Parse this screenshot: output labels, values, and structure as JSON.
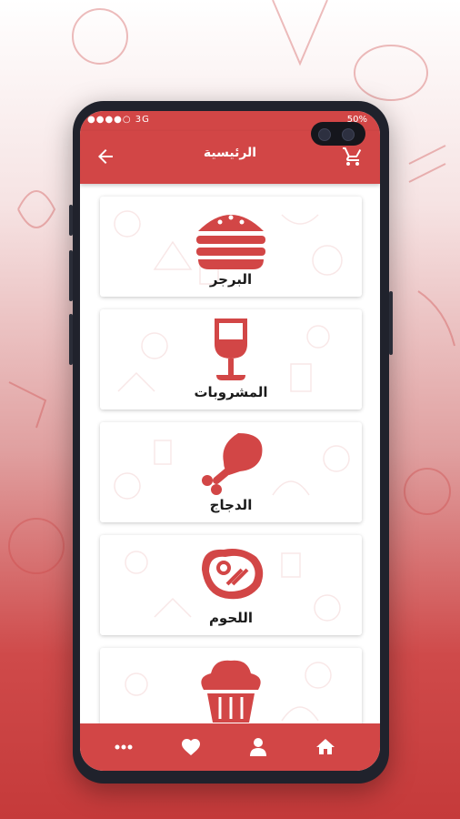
{
  "statusbar": {
    "carrier": "●●●●○ 3G",
    "battery": "50%"
  },
  "header": {
    "title": "الرئيسية",
    "back_icon": "arrow-left-icon",
    "cart_icon": "cart-icon"
  },
  "categories": [
    {
      "label": "البرجر",
      "icon": "burger-icon"
    },
    {
      "label": "المشروبات",
      "icon": "wine-glass-icon"
    },
    {
      "label": "الدجاج",
      "icon": "chicken-leg-icon"
    },
    {
      "label": "اللحوم",
      "icon": "steak-icon"
    },
    {
      "label": "",
      "icon": "cupcake-icon"
    }
  ],
  "bottom_nav": [
    {
      "icon": "more-icon"
    },
    {
      "icon": "heart-icon"
    },
    {
      "icon": "user-icon"
    },
    {
      "icon": "home-icon"
    }
  ],
  "colors": {
    "primary": "#d24646",
    "phone_frame": "#20222c"
  }
}
